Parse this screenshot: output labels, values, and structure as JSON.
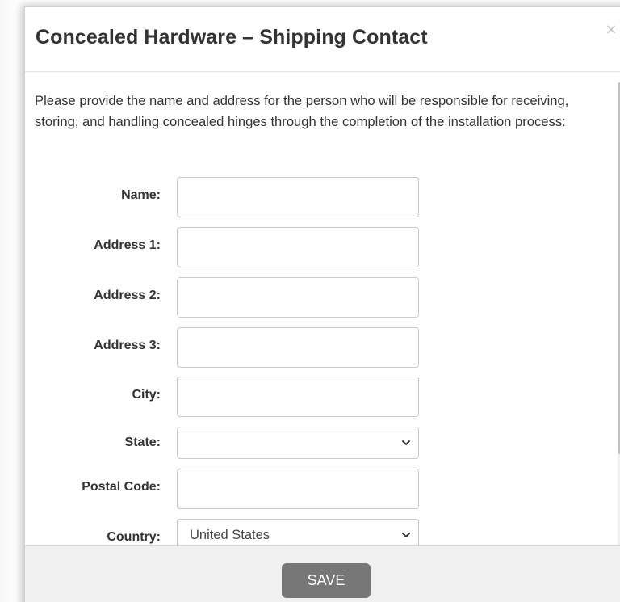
{
  "modal": {
    "title": "Concealed Hardware – Shipping Contact",
    "close_label": "×",
    "intro": "Please provide the name and address for the person who will be responsible for receiving, storing, and handling concealed hinges through the completion of the installation process:",
    "save_label": "SAVE"
  },
  "form": {
    "name_label": "Name:",
    "name_value": "",
    "address1_label": "Address 1:",
    "address1_value": "",
    "address2_label": "Address 2:",
    "address2_value": "",
    "address3_label": "Address 3:",
    "address3_value": "",
    "city_label": "City:",
    "city_value": "",
    "state_label": "State:",
    "state_value": "",
    "postal_label": "Postal Code:",
    "postal_value": "",
    "country_label": "Country:",
    "country_value": "United States"
  },
  "icons": {
    "close": "close-icon",
    "chevron": "chevron-down-icon"
  },
  "colors": {
    "save_button_bg": "#777777",
    "footer_bg": "#f0f0f0",
    "text": "#333333"
  }
}
